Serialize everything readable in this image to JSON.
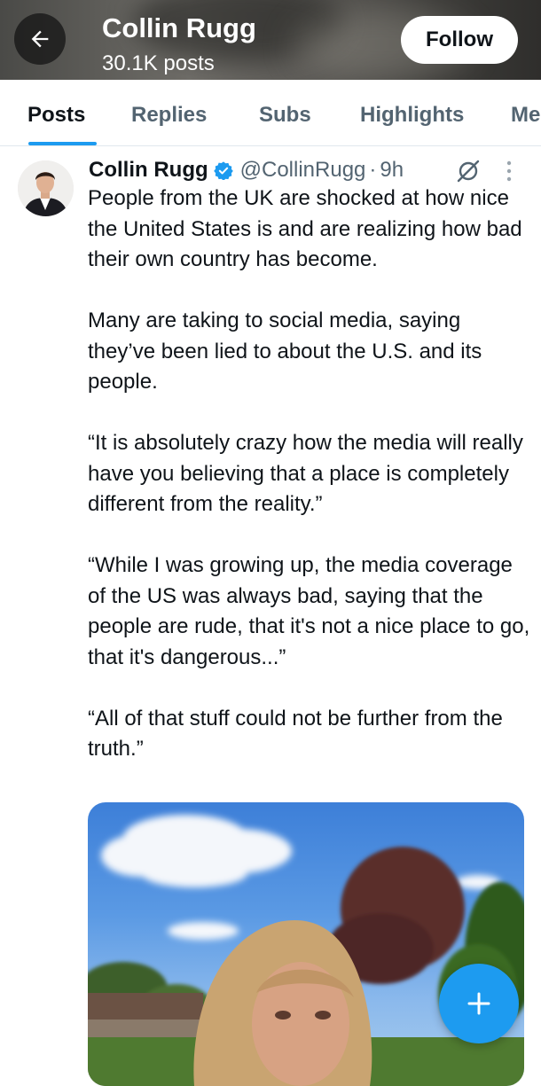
{
  "header": {
    "name": "Collin Rugg",
    "posts_count": "30.1K posts",
    "follow_label": "Follow",
    "back_icon": "arrow-left-icon"
  },
  "tabs": [
    {
      "label": "Posts",
      "active": true
    },
    {
      "label": "Replies",
      "active": false
    },
    {
      "label": "Subs",
      "active": false
    },
    {
      "label": "Highlights",
      "active": false
    },
    {
      "label": "Me",
      "active": false
    }
  ],
  "tweet": {
    "author_name": "Collin Rugg",
    "handle": "@CollinRugg",
    "separator": "·",
    "time": "9h",
    "paragraphs": [
      "People from the UK are shocked at how nice the United States is and are realizing how bad their own country has become.",
      "Many are taking to social media, saying they’ve been lied to about the U.S. and its people.",
      "“It is absolutely crazy how the media will really have you believing that a place is completely different from the reality.”",
      "“While I was growing up, the media coverage of the US was always bad, saying that the people are rude, that it's not a nice place to go, that it's dangerous...”",
      "“All of that stuff could not be further from the truth.”"
    ]
  },
  "colors": {
    "accent": "#1d9bf0",
    "text_primary": "#0f1419",
    "text_secondary": "#536471"
  },
  "icons": {
    "verified": "verified-badge-icon",
    "grok": "grok-icon",
    "more": "more-vertical-icon",
    "compose": "plus-icon"
  }
}
